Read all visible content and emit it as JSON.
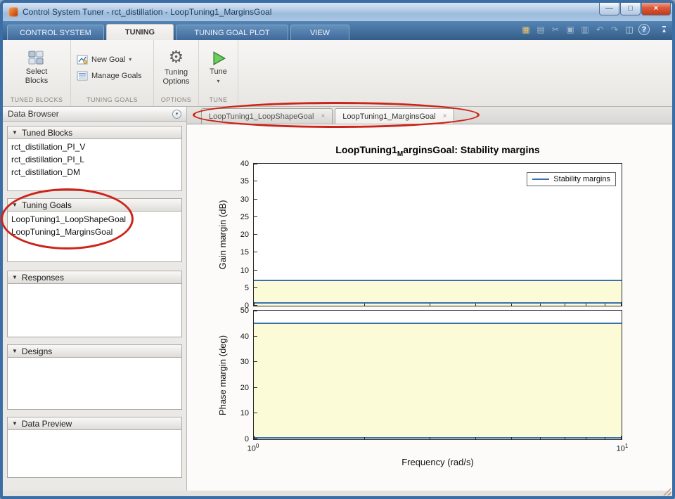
{
  "window": {
    "title": "Control System Tuner - rct_distillation - LoopTuning1_MarginsGoal"
  },
  "icons": {
    "minimize": "—",
    "maximize": "□",
    "close": "×",
    "plot_browser": "▦",
    "save": "▤",
    "cut": "✂",
    "copy": "▣",
    "paste": "▥",
    "undo": "↶",
    "redo": "↷",
    "layout": "◫",
    "help": "?",
    "section_arrow": "▼",
    "dropdown_arrow": "▾",
    "gear": "⚙",
    "tab_close": "×",
    "browser_menu": "▾"
  },
  "ribbon_tabs": [
    "CONTROL SYSTEM",
    "TUNING",
    "TUNING GOAL PLOT",
    "VIEW"
  ],
  "active_ribbon_tab": "TUNING",
  "ribbon": {
    "select_blocks": "Select Blocks",
    "new_goal": "New Goal",
    "manage_goals": "Manage Goals",
    "tuning_options": "Tuning Options",
    "tune": "Tune",
    "sections": [
      "TUNED BLOCKS",
      "TUNING GOALS",
      "OPTIONS",
      "TUNE"
    ]
  },
  "data_browser": {
    "title": "Data Browser",
    "sections": [
      {
        "label": "Tuned Blocks",
        "items": [
          "rct_distillation_PI_V",
          "rct_distillation_PI_L",
          "rct_distillation_DM"
        ]
      },
      {
        "label": "Tuning Goals",
        "items": [
          "LoopTuning1_LoopShapeGoal",
          "LoopTuning1_MarginsGoal"
        ]
      },
      {
        "label": "Responses",
        "items": []
      },
      {
        "label": "Designs",
        "items": []
      },
      {
        "label": "Data Preview",
        "items": []
      }
    ]
  },
  "document": {
    "tabs": [
      "LoopTuning1_LoopShapeGoal",
      "LoopTuning1_MarginsGoal"
    ],
    "active_tab": "LoopTuning1_MarginsGoal"
  },
  "annotations": [
    {
      "shape": "ellipse",
      "color": "#cc2419",
      "around": "document-tabs"
    },
    {
      "shape": "ellipse",
      "color": "#cc2419",
      "around": "tuning-goals-section"
    }
  ],
  "chart_data": {
    "type": "area",
    "title": "LoopTuning1_MarginsGoal: Stability margins",
    "title_parts": {
      "pre": "LoopTuning1",
      "sub": "M",
      "post": "arginsGoal: Stability margins"
    },
    "xlabel": "Frequency  (rad/s)",
    "x_scale": "log",
    "xlim": [
      1,
      10
    ],
    "xticks": [
      {
        "base": "10",
        "exp": "0"
      },
      {
        "base": "10",
        "exp": "1"
      }
    ],
    "legend": [
      "Stability margins"
    ],
    "legend_position": "northeast",
    "grid": false,
    "line_color": "#3a6fb0",
    "region_color": "#fbfbd7",
    "subplots": [
      {
        "ylabel": "Gain margin (dB)",
        "ylim": [
          0,
          40
        ],
        "yticks": [
          0,
          5,
          10,
          15,
          20,
          25,
          30,
          35,
          40
        ],
        "shaded_region": [
          0,
          7.2
        ],
        "lines": [
          {
            "name": "gain-margin-requirement",
            "y": 7.2
          },
          {
            "name": "gain-margin-baseline",
            "y": 0.8
          }
        ]
      },
      {
        "ylabel": "Phase margin (deg)",
        "ylim": [
          0,
          50
        ],
        "yticks": [
          0,
          10,
          20,
          30,
          40,
          50
        ],
        "shaded_region": [
          0,
          45
        ],
        "lines": [
          {
            "name": "phase-margin-requirement",
            "y": 45
          },
          {
            "name": "phase-margin-baseline",
            "y": 0.6
          }
        ]
      }
    ]
  }
}
